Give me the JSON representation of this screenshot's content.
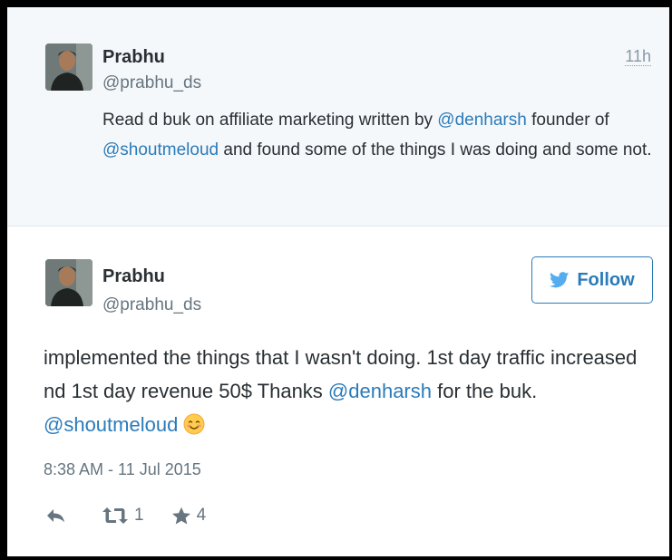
{
  "parent_tweet": {
    "author_name": "Prabhu",
    "author_handle": "@prabhu_ds",
    "time": "11h",
    "text_parts": [
      "Read d buk on affiliate marketing written by ",
      "@denharsh",
      " founder of ",
      "@shoutmeloud",
      " and found some of the things I was doing and some not."
    ]
  },
  "main_tweet": {
    "author_name": "Prabhu",
    "author_handle": "@prabhu_ds",
    "follow_label": "Follow",
    "text_parts": [
      "implemented the things that I wasn't doing. 1st day traffic increased nd 1st day revenue 50$ Thanks ",
      "@denharsh",
      " for the buk. ",
      "@shoutmeloud"
    ],
    "emoji": "smiling-face-icon",
    "timestamp": "8:38 AM - 11 Jul 2015",
    "actions": {
      "reply_icon": "reply-icon",
      "retweet_icon": "retweet-icon",
      "retweet_count": "1",
      "favorite_icon": "star-icon",
      "favorite_count": "4"
    }
  },
  "colors": {
    "link": "#2b7bb9",
    "text": "#292f33",
    "muted": "#66757f",
    "parent_background": "#f5f8fa"
  }
}
